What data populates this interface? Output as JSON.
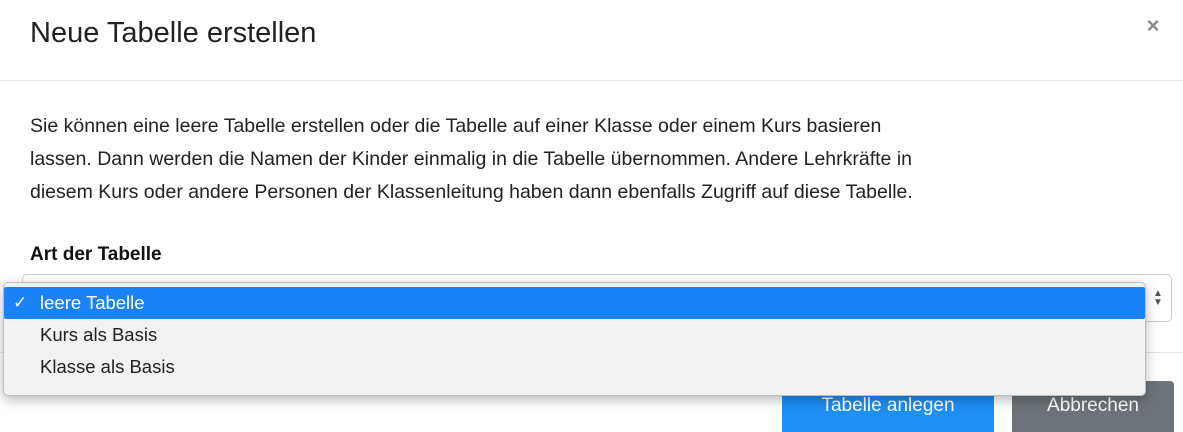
{
  "dialog": {
    "title": "Neue Tabelle erstellen",
    "close_icon": "×"
  },
  "body": {
    "intro_lines": [
      "Sie können eine leere Tabelle erstellen oder die Tabelle auf einer Klasse oder einem Kurs basieren",
      "lassen. Dann werden die Namen der Kinder einmalig in die Tabelle übernommen. Andere Lehrkräfte in",
      "diesem Kurs oder andere Personen der Klassenleitung haben dann ebenfalls Zugriff auf diese Tabelle."
    ],
    "type_label": "Art der Tabelle",
    "select": {
      "selected_value": "leere Tabelle",
      "arrow_icon": "⇅",
      "options": [
        {
          "label": "leere Tabelle",
          "check": "✓"
        },
        {
          "label": "Kurs als Basis",
          "check": ""
        },
        {
          "label": "Klasse als Basis",
          "check": ""
        }
      ]
    }
  },
  "footer": {
    "create_label": "Tabelle anlegen",
    "cancel_label": "Abbrechen"
  },
  "colors": {
    "accent": "#1a82f6",
    "secondary": "#6d7378"
  }
}
